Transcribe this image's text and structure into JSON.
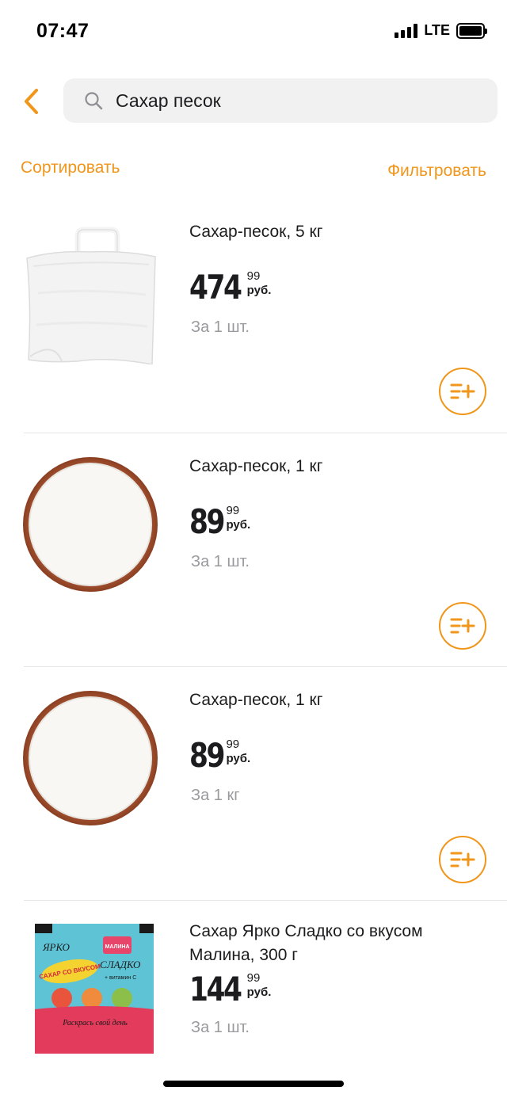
{
  "status_bar": {
    "time": "07:47",
    "network": "LTE"
  },
  "search": {
    "query": "Сахар песок"
  },
  "toolbar": {
    "sort_label": "Сортировать",
    "filter_label": "Фильтровать"
  },
  "accent_color": "#f0961b",
  "products": [
    {
      "title": "Сахар-песок, 5 кг",
      "price_main": "474",
      "price_kop": "99",
      "currency": "руб.",
      "unit": "За 1 шт.",
      "image": "white-sugar-bag"
    },
    {
      "title": "Сахар-песок, 1 кг",
      "price_main": "89",
      "price_kop": "99",
      "currency": "руб.",
      "unit": "За 1 шт.",
      "image": "sugar-bowl"
    },
    {
      "title": "Сахар-песок, 1 кг",
      "price_main": "89",
      "price_kop": "99",
      "currency": "руб.",
      "unit": "За 1 кг",
      "image": "sugar-bowl"
    },
    {
      "title": "Сахар Ярко Сладко со вкусом Малина, 300 г",
      "price_main": "144",
      "price_kop": "99",
      "currency": "руб.",
      "unit": "За 1 шт.",
      "image": "raspberry-sugar-pack",
      "package_text": {
        "brand_top": "ЯРКО",
        "brand_right": "СЛАДКО",
        "flavor_badge": "МАЛИНА",
        "flavor_line": "САХАР СО ВКУСОМ",
        "vitamin": "+ витамин С",
        "slogan": "Раскрась свой день"
      }
    }
  ],
  "icons": {
    "back": "chevron-left-icon",
    "search": "search-icon",
    "add_to_list": "add-to-list-icon"
  }
}
